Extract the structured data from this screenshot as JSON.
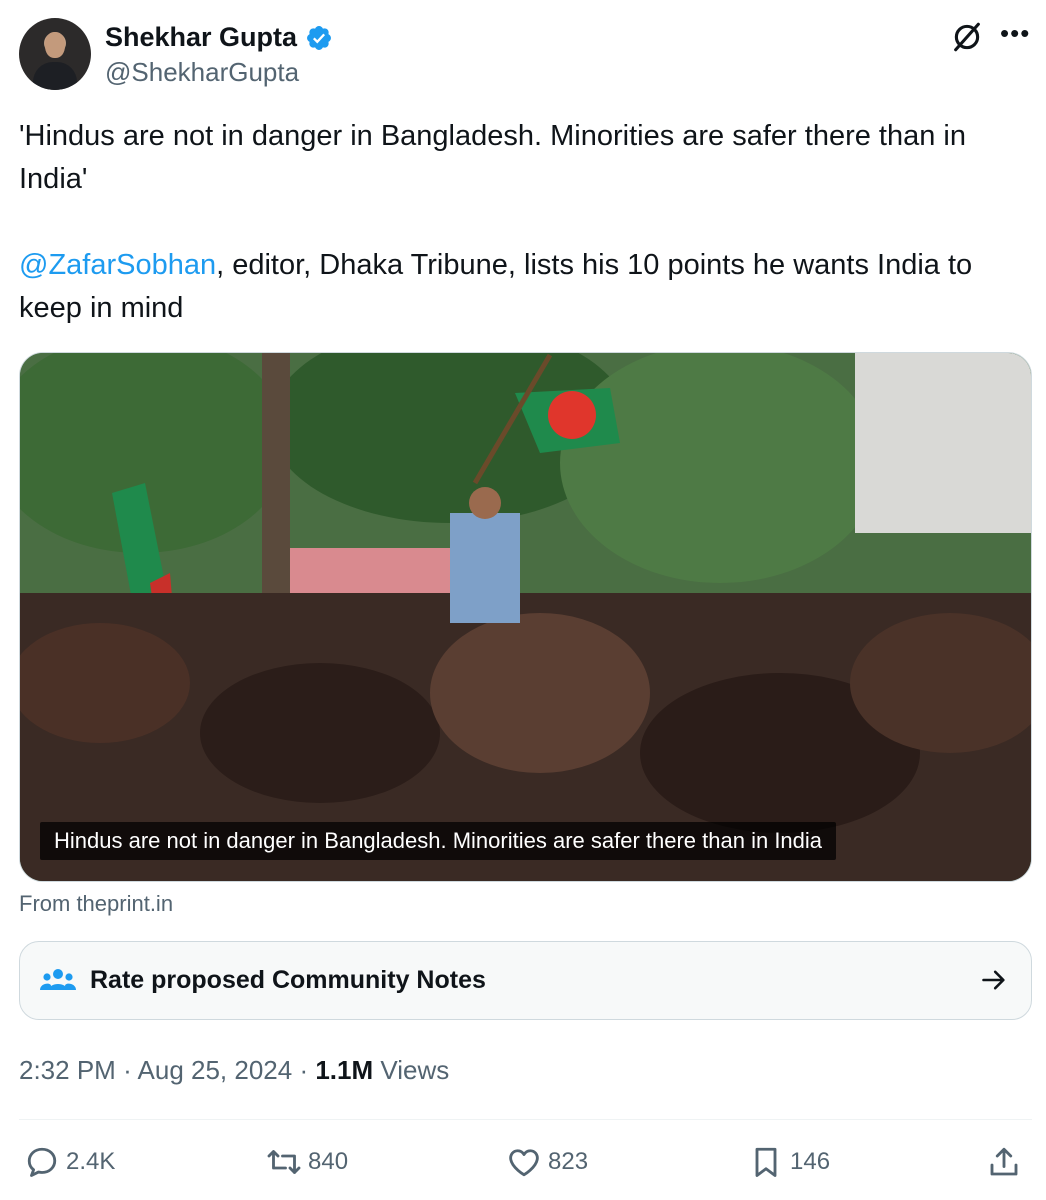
{
  "author": {
    "name": "Shekhar Gupta",
    "handle": "@ShekharGupta"
  },
  "tweet": {
    "line1": "'Hindus are not in danger in Bangladesh. Minorities are safer there than in India'",
    "mention": "@ZafarSobhan",
    "line2_rest": ", editor, Dhaka Tribune, lists his 10 points he wants India to keep in mind"
  },
  "media": {
    "caption": "Hindus are not in danger in Bangladesh. Minorities are safer there than in India",
    "source": "From theprint.in"
  },
  "community_notes": {
    "label": "Rate proposed Community Notes"
  },
  "meta": {
    "time": "2:32 PM",
    "date": "Aug 25, 2024",
    "views_count": "1.1M",
    "views_label": "Views"
  },
  "actions": {
    "replies": "2.4K",
    "reposts": "840",
    "likes": "823",
    "bookmarks": "146"
  },
  "icons": {
    "verified": "verified-badge-icon",
    "grok": "grok-icon",
    "more": "more-icon",
    "notes": "people-icon",
    "arrow": "arrow-right-icon",
    "reply": "reply-icon",
    "repost": "repost-icon",
    "like": "heart-icon",
    "bookmark": "bookmark-icon",
    "share": "share-icon"
  },
  "colors": {
    "accent": "#1d9bf0",
    "secondary_text": "#536471",
    "primary_text": "#0f1419"
  }
}
